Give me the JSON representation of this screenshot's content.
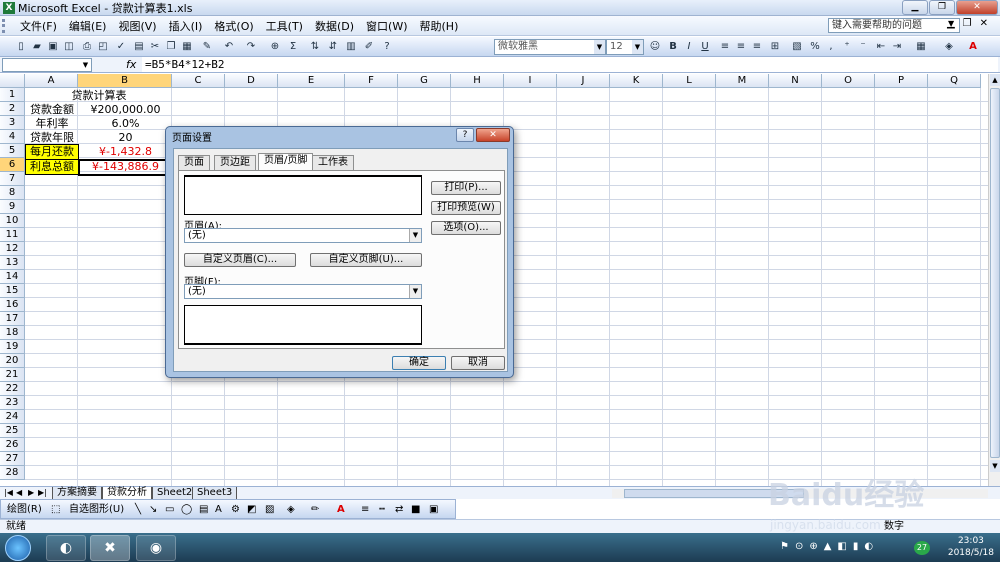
{
  "window": {
    "title": "Microsoft Excel - 贷款计算表1.xls",
    "app_icon": "excel-icon"
  },
  "menu": {
    "items": [
      "文件(F)",
      "编辑(E)",
      "视图(V)",
      "插入(I)",
      "格式(O)",
      "工具(T)",
      "数据(D)",
      "窗口(W)",
      "帮助(H)"
    ],
    "help_placeholder": "键入需要帮助的问题"
  },
  "toolbar": {
    "font_name": "微软雅黑",
    "font_size": "12"
  },
  "formula_bar": {
    "name_box": "",
    "fx_label": "fx",
    "formula": "=B5*B4*12+B2"
  },
  "sheet": {
    "columns": [
      "A",
      "B",
      "C",
      "D",
      "E",
      "F",
      "G",
      "H",
      "I",
      "J",
      "K",
      "L",
      "M",
      "N",
      "O",
      "P",
      "Q"
    ],
    "rows": [
      "1",
      "2",
      "3",
      "4",
      "5",
      "6",
      "7",
      "8",
      "9",
      "10",
      "11",
      "12",
      "13",
      "14",
      "15",
      "16",
      "17",
      "18",
      "19",
      "20",
      "21",
      "22",
      "23",
      "24",
      "25",
      "26",
      "27",
      "28"
    ],
    "title": "贷款计算表",
    "cells": {
      "a2": "贷款金额",
      "b2": "¥200,000.00",
      "a3": "年利率",
      "b3": "6.0%",
      "a4": "贷款年限",
      "b4": "20",
      "a5": "每月还款",
      "b5": "¥-1,432.8",
      "a6": "利息总额",
      "b6": "¥-143,886.9"
    }
  },
  "sheet_tabs": [
    "方案摘要",
    "贷款分析",
    "Sheet2",
    "Sheet3"
  ],
  "draw_toolbar": {
    "draw_label": "绘图(R)",
    "autoshape_label": "自选图形(U)"
  },
  "status": {
    "ready": "就绪",
    "num": "数字"
  },
  "taskbar": {
    "time": "23:03",
    "date": "2018/5/18",
    "badge": "27"
  },
  "watermark": {
    "brand": "Baidu经验",
    "url": "jingyan.baidu.com"
  },
  "dialog": {
    "title": "页面设置",
    "help": "?",
    "close": "✕",
    "tabs": [
      "页面",
      "页边距",
      "页眉/页脚",
      "工作表"
    ],
    "header_label": "页眉(A):",
    "header_value": "(无)",
    "custom_header": "自定义页眉(C)...",
    "custom_footer": "自定义页脚(U)...",
    "footer_label": "页脚(F):",
    "footer_value": "(无)",
    "print": "打印(P)...",
    "print_preview": "打印预览(W)",
    "options": "选项(O)...",
    "ok": "确定",
    "cancel": "取消"
  }
}
